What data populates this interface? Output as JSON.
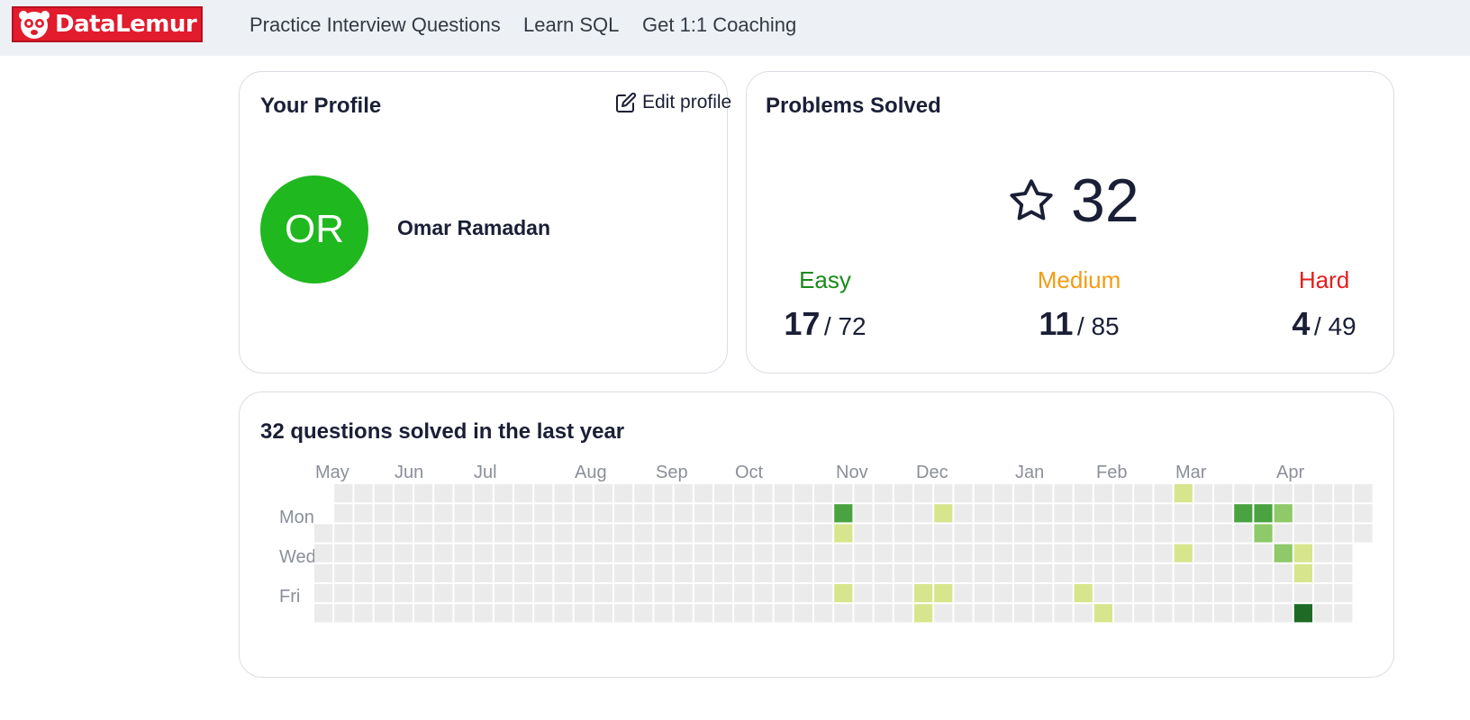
{
  "brand": {
    "name": "DataLemur",
    "primary_color": "#e21b2d"
  },
  "nav": {
    "links": [
      "Practice Interview Questions",
      "Learn SQL",
      "Get 1:1 Coaching"
    ]
  },
  "profile": {
    "title": "Your Profile",
    "edit_label": "Edit profile",
    "initials": "OR",
    "avatar_color": "#1fb81f",
    "name": "Omar Ramadan"
  },
  "problems": {
    "title": "Problems Solved",
    "total": "32",
    "difficulties": [
      {
        "label": "Easy",
        "solved": "17",
        "total": "/ 72",
        "color": "#1a8a1a"
      },
      {
        "label": "Medium",
        "solved": "11",
        "total": "/ 85",
        "color": "#f39c12"
      },
      {
        "label": "Hard",
        "solved": "4",
        "total": "/ 49",
        "color": "#e81c1c"
      }
    ]
  },
  "activity": {
    "title": "32 questions solved in the last year",
    "months": [
      "May",
      "Jun",
      "Jul",
      "Aug",
      "Sep",
      "Oct",
      "Nov",
      "Dec",
      "Jan",
      "Feb",
      "Mar",
      "Apr"
    ],
    "day_labels": [
      "Mon",
      "Wed",
      "Fri"
    ],
    "colors": {
      "empty": "#ebebeb",
      "l1": "#d7e68d",
      "l2": "#8ec96a",
      "l3": "#4aa341",
      "l4": "#1f6b25"
    },
    "solved_cells": [
      {
        "week": 43,
        "day": 0,
        "level": "l1"
      },
      {
        "week": 26,
        "day": 1,
        "level": "l3"
      },
      {
        "week": 31,
        "day": 1,
        "level": "l1"
      },
      {
        "week": 46,
        "day": 1,
        "level": "l3"
      },
      {
        "week": 47,
        "day": 1,
        "level": "l3"
      },
      {
        "week": 48,
        "day": 1,
        "level": "l2"
      },
      {
        "week": 26,
        "day": 2,
        "level": "l1"
      },
      {
        "week": 47,
        "day": 2,
        "level": "l2"
      },
      {
        "week": 43,
        "day": 3,
        "level": "l1"
      },
      {
        "week": 48,
        "day": 3,
        "level": "l2"
      },
      {
        "week": 49,
        "day": 3,
        "level": "l1"
      },
      {
        "week": 49,
        "day": 4,
        "level": "l1"
      },
      {
        "week": 26,
        "day": 5,
        "level": "l1"
      },
      {
        "week": 30,
        "day": 5,
        "level": "l1"
      },
      {
        "week": 31,
        "day": 5,
        "level": "l1"
      },
      {
        "week": 38,
        "day": 5,
        "level": "l1"
      },
      {
        "week": 30,
        "day": 6,
        "level": "l1"
      },
      {
        "week": 39,
        "day": 6,
        "level": "l1"
      },
      {
        "week": 49,
        "day": 6,
        "level": "l4"
      }
    ]
  }
}
